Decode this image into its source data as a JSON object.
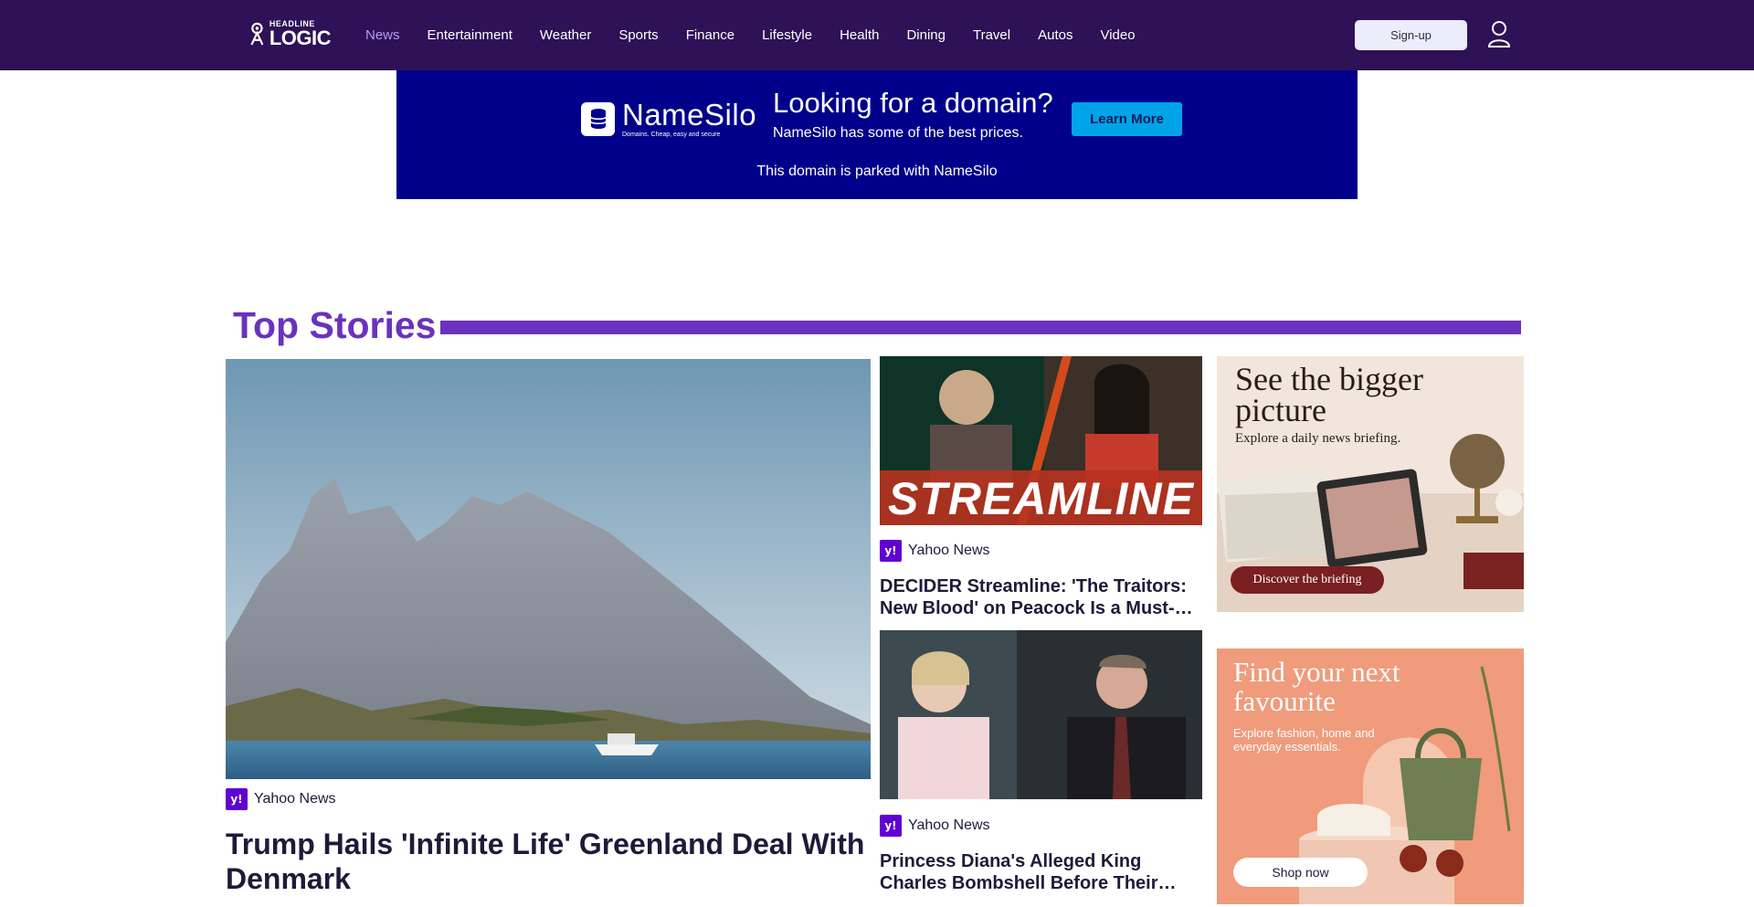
{
  "nav": {
    "logo_top": "HEADLINE",
    "logo_bottom": "LOGIC",
    "items": [
      "News",
      "Entertainment",
      "Weather",
      "Sports",
      "Finance",
      "Lifestyle",
      "Health",
      "Dining",
      "Travel",
      "Autos",
      "Video"
    ],
    "active": "News",
    "signup_label": "Sign-up"
  },
  "ad": {
    "brand": "NameSilo",
    "tagline": "Domains. Cheap, easy and secure",
    "headline": "Looking for a domain?",
    "sub": "NameSilo has some of the best prices.",
    "button": "Learn More",
    "footer": "This domain is parked with NameSilo",
    "colors": {
      "background": "#00008b",
      "button": "#00a3e8"
    }
  },
  "section": {
    "title": "Top Stories",
    "accent": "#6a32bd"
  },
  "stories": [
    {
      "source": "Yahoo News",
      "headline": "Trump Hails 'Infinite Life' Greenland Deal With Denmark",
      "image": "mountain-island-photo"
    },
    {
      "source": "Yahoo News",
      "headline": "DECIDER Streamline: 'The Traitors: New Blood' on Peacock Is a Must-Watch",
      "image_text": "STREAMLINE"
    },
    {
      "source": "Yahoo News",
      "headline": "Princess Diana's Alleged King Charles Bombshell Before Their Divorce",
      "image": "royal-couple-photo"
    }
  ],
  "ads": [
    {
      "headline": "See the bigger picture",
      "sub": "Explore a daily news briefing.",
      "cta": "Discover the briefing"
    },
    {
      "headline": "Find your next favourite",
      "sub": "Explore fashion, home and everyday essentials.",
      "cta": "Shop now"
    }
  ]
}
